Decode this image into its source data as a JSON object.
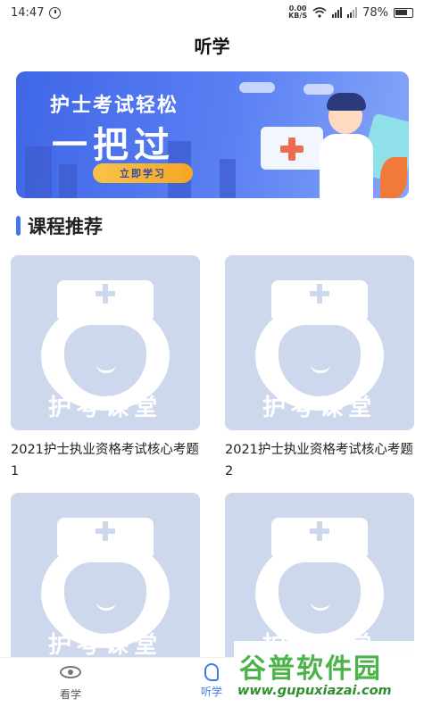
{
  "status_bar": {
    "time": "14:47",
    "net_speed_value": "0.00",
    "net_speed_unit": "KB/S",
    "battery": "78%"
  },
  "header": {
    "title": "听学"
  },
  "banner": {
    "headline": "护士考试轻松",
    "big_text": "一把过",
    "button_label": "立即学习"
  },
  "section": {
    "title": "课程推荐"
  },
  "courses": [
    {
      "thumb_label": "护考课堂",
      "title": "2021护士执业资格考试核心考题1"
    },
    {
      "thumb_label": "护考课堂",
      "title": "2021护士执业资格考试核心考题2"
    },
    {
      "thumb_label": "护考课堂",
      "title": ""
    },
    {
      "thumb_label": "护考课堂",
      "title": ""
    }
  ],
  "tabbar": {
    "tabs": [
      {
        "label": "看学",
        "icon": "eye-icon",
        "active": false
      },
      {
        "label": "听学",
        "icon": "ear-icon",
        "active": true
      }
    ]
  },
  "watermark": {
    "name": "谷普软件园",
    "url": "www.gupuxiazai.com"
  },
  "colors": {
    "accent": "#3f79f2",
    "thumb_bg": "#cdd8ec",
    "banner": "#4a6ee8"
  }
}
